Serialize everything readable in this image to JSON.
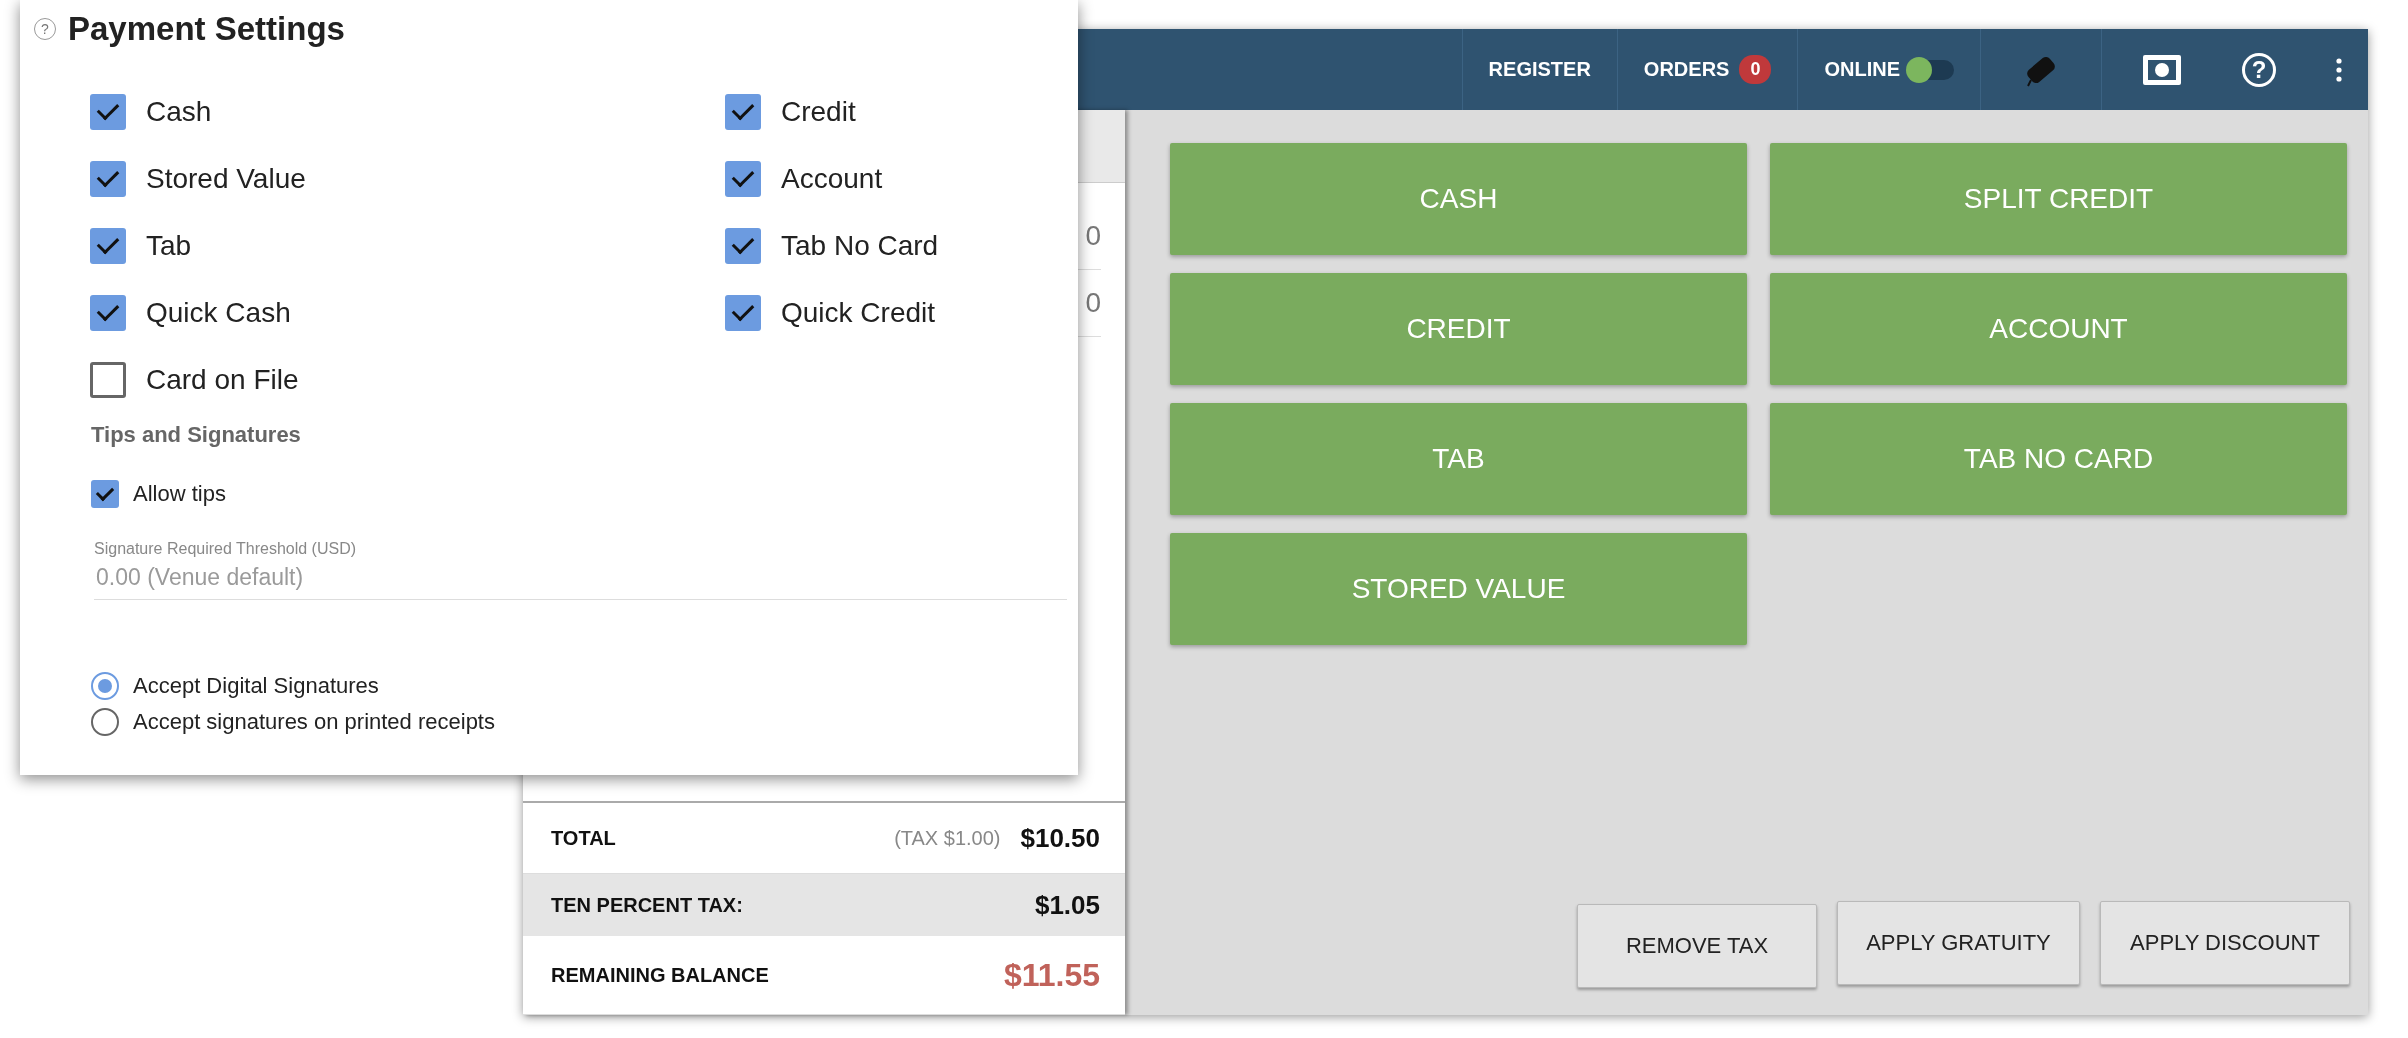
{
  "header": {
    "nav": [
      {
        "label": "REGISTER"
      },
      {
        "label": "ORDERS",
        "badge": "0"
      }
    ],
    "online": {
      "label": "ONLINE",
      "on": true
    },
    "help": "?"
  },
  "order_rows": [
    {
      "value": "0"
    },
    {
      "value": "0"
    }
  ],
  "totals": [
    {
      "kind": "total",
      "label": "TOTAL",
      "note": "(TAX $1.00)",
      "amount": "$10.50"
    },
    {
      "kind": "tax",
      "label": "TEN PERCENT TAX:",
      "amount": "$1.05"
    },
    {
      "kind": "balance",
      "label": "REMAINING BALANCE",
      "amount": "$11.55"
    }
  ],
  "payment_buttons": [
    "CASH",
    "SPLIT CREDIT",
    "CREDIT",
    "ACCOUNT",
    "TAB",
    "TAB NO CARD",
    "STORED VALUE"
  ],
  "action_buttons": [
    "REMOVE TAX",
    "APPLY GRATUITY",
    "APPLY DISCOUNT"
  ],
  "settings": {
    "help": "?",
    "title": "Payment Settings",
    "options": [
      {
        "label": "Cash",
        "checked": true
      },
      {
        "label": "Credit",
        "checked": true
      },
      {
        "label": "Stored Value",
        "checked": true
      },
      {
        "label": "Account",
        "checked": true
      },
      {
        "label": "Tab",
        "checked": true
      },
      {
        "label": "Tab No Card",
        "checked": true
      },
      {
        "label": "Quick Cash",
        "checked": true
      },
      {
        "label": "Quick Credit",
        "checked": true
      },
      {
        "label": "Card on File",
        "checked": false
      }
    ],
    "section": "Tips and Signatures",
    "allow_tips": {
      "label": "Allow tips",
      "checked": true
    },
    "threshold": {
      "label": "Signature Required Threshold (USD)",
      "placeholder": "0.00 (Venue default)"
    },
    "signature_modes": [
      {
        "label": "Accept Digital Signatures",
        "selected": true
      },
      {
        "label": "Accept signatures on printed receipts",
        "selected": false
      }
    ]
  }
}
